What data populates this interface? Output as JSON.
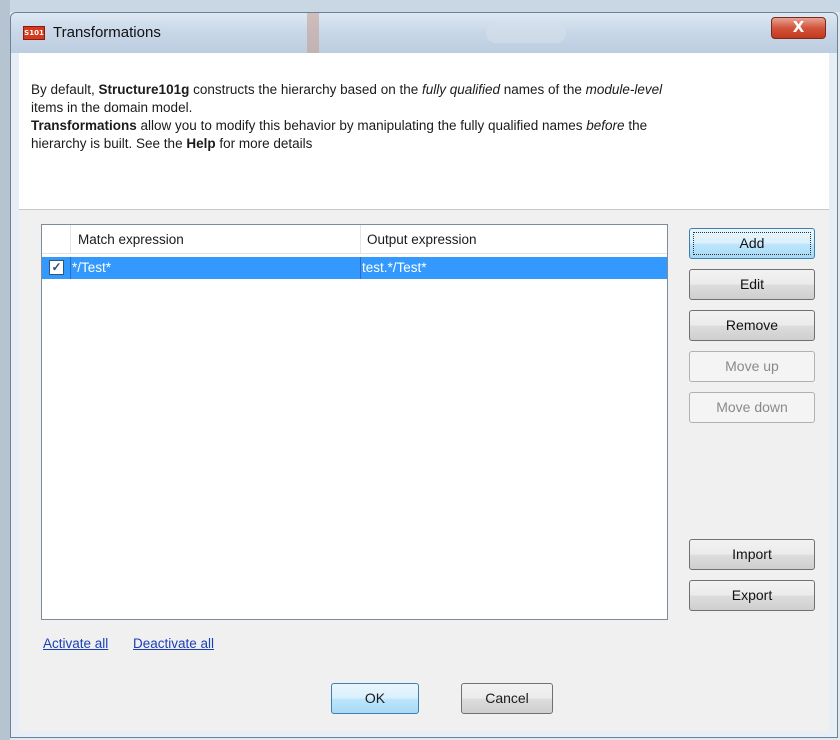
{
  "window": {
    "title": "Transformations",
    "logo_text": "S101",
    "close_label": "X"
  },
  "description": {
    "l1_a": "By default, ",
    "l1_b": "Structure101g",
    "l1_c": " constructs the hierarchy based on the ",
    "l1_d": "fully qualified",
    "l1_e": " names of the ",
    "l1_f": "module-level",
    "l2": "items in the domain model.",
    "l3_a": "Transformations",
    "l3_b": " allow you to modify this behavior by manipulating the fully qualified names ",
    "l3_c": "before",
    "l3_d": " the",
    "l4_a": "hierarchy is built. See the ",
    "l4_b": "Help",
    "l4_c": " for more details"
  },
  "table": {
    "columns": [
      "Match expression",
      "Output expression"
    ],
    "rows": [
      {
        "checked": true,
        "check_glyph": "✓",
        "match": "*/Test*",
        "output": "test.*/Test*"
      }
    ]
  },
  "buttons": {
    "add": "Add",
    "edit": "Edit",
    "remove": "Remove",
    "move_up": "Move up",
    "move_down": "Move down",
    "import": "Import",
    "export": "Export",
    "ok": "OK",
    "cancel": "Cancel"
  },
  "links": {
    "activate_all": "Activate all",
    "deactivate_all": "Deactivate all"
  },
  "colors": {
    "selection": "#3399ff",
    "link": "#1a3fb6",
    "close_button": "#c1391f"
  }
}
